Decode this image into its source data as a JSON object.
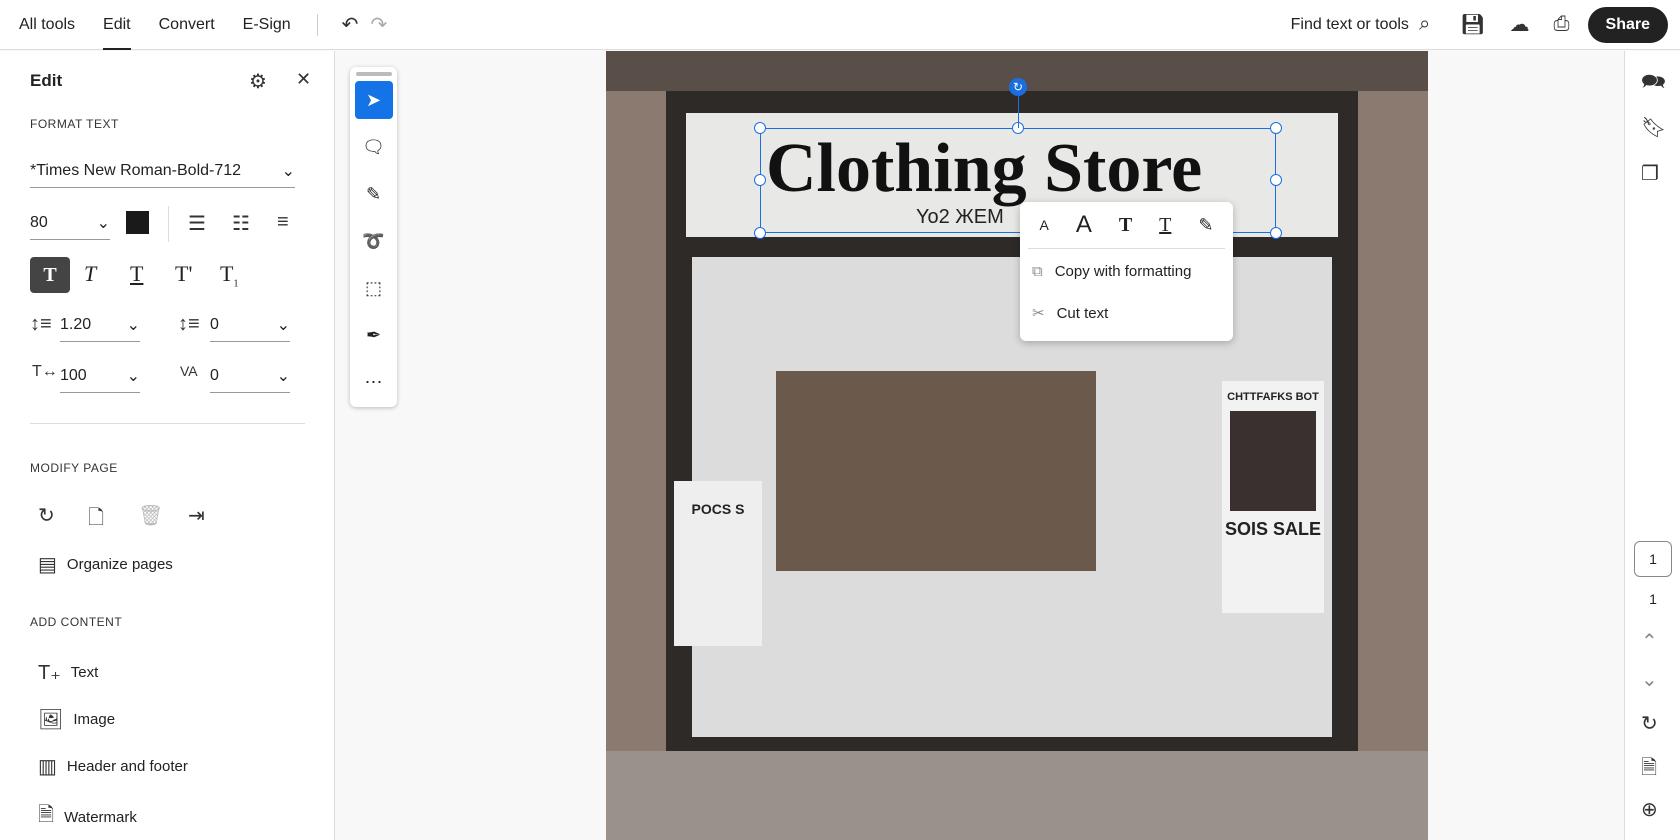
{
  "topbar": {
    "tabs": [
      "All tools",
      "Edit",
      "Convert",
      "E-Sign"
    ],
    "active": "Edit",
    "find": "Find text or tools",
    "share": "Share"
  },
  "panel": {
    "title": "Edit",
    "format_text": "FORMAT TEXT",
    "font": "*Times New Roman-Bold-712",
    "size": "80",
    "text_color": "#1a1a1a",
    "line_spacing": "1.20",
    "para_spacing": "0",
    "h_scale": "100",
    "char_spacing": "0",
    "modify_page": "MODIFY PAGE",
    "organize": "Organize pages",
    "add_content": "ADD CONTENT",
    "add_items": [
      "Text",
      "Image",
      "Header and footer",
      "Watermark"
    ]
  },
  "document": {
    "sign_text": "Clothing Store",
    "sub_text": "Yo2 ЖЕМ",
    "poster_left": "POCS S",
    "poster_right": "CHTTFAFKS BOT",
    "poster_sale": "SOIS SALE"
  },
  "context_menu": {
    "items": [
      "Copy with formatting",
      "Cut text"
    ]
  },
  "page_nav": {
    "current": "1",
    "total": "1"
  },
  "colors": {
    "accent": "#1473e6"
  }
}
